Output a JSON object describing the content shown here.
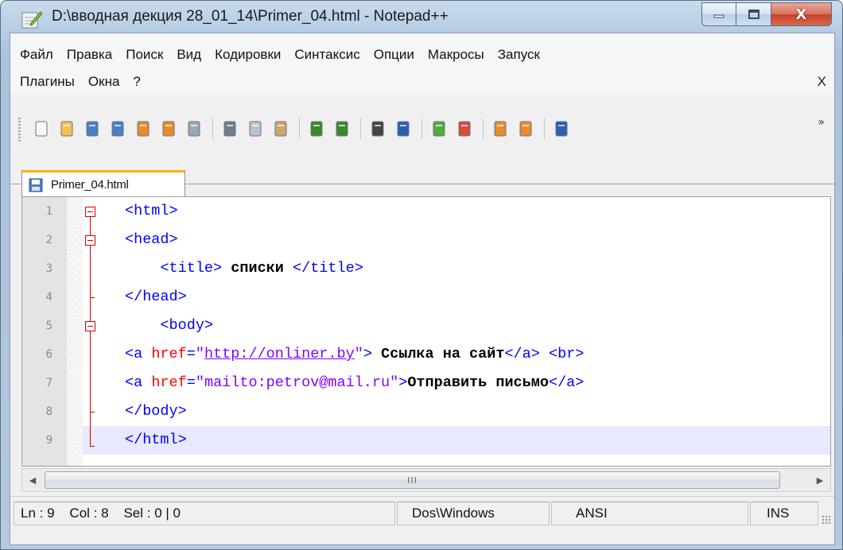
{
  "window": {
    "title": "D:\\вводная декция 28_01_14\\Primer_04.html - Notepad++",
    "close_glyph": "X"
  },
  "menu": {
    "row1": [
      "Файл",
      "Правка",
      "Поиск",
      "Вид",
      "Кодировки",
      "Синтаксис",
      "Опции",
      "Макросы",
      "Запуск"
    ],
    "row2": [
      "Плагины",
      "Окна",
      "?"
    ],
    "close_label": "X"
  },
  "toolbar": {
    "icons": [
      "new-file-icon",
      "open-file-icon",
      "save-icon",
      "save-all-icon",
      "close-icon",
      "close-all-icon",
      "print-icon",
      "cut-icon",
      "copy-icon",
      "paste-icon",
      "undo-icon",
      "redo-icon",
      "find-icon",
      "replace-icon",
      "zoom-in-icon",
      "zoom-out-icon",
      "sync-vertical-icon",
      "sync-horizontal-icon",
      "word-wrap-icon"
    ],
    "more": "»"
  },
  "tab": {
    "label": "Primer_04.html"
  },
  "editor": {
    "line_numbers": [
      "1",
      "2",
      "3",
      "4",
      "5",
      "6",
      "7",
      "8",
      "9"
    ],
    "current_line": 9,
    "lines": [
      "<html>",
      "<head>",
      "    <title> списки </title>",
      "</head>",
      "    <body>",
      "<a href=\"http://onliner.by\"> Ссылка на сайт</a> <br>",
      "<a href=\"mailto:petrov@mail.ru\">Отправить письмо</a>",
      "</body>",
      "</html>"
    ]
  },
  "scrollbar": {
    "thumb_grip": "III"
  },
  "statusbar": {
    "position": "Ln : 9    Col : 8    Sel : 0 | 0",
    "eol": "Dos\\Windows",
    "encoding": "ANSI",
    "mode": "INS"
  },
  "colors": {
    "tag": "#0000ff",
    "attribute": "#ff0000",
    "string": "#8000ff",
    "fold": "#d00000",
    "current_line": "#e8e8ff"
  }
}
